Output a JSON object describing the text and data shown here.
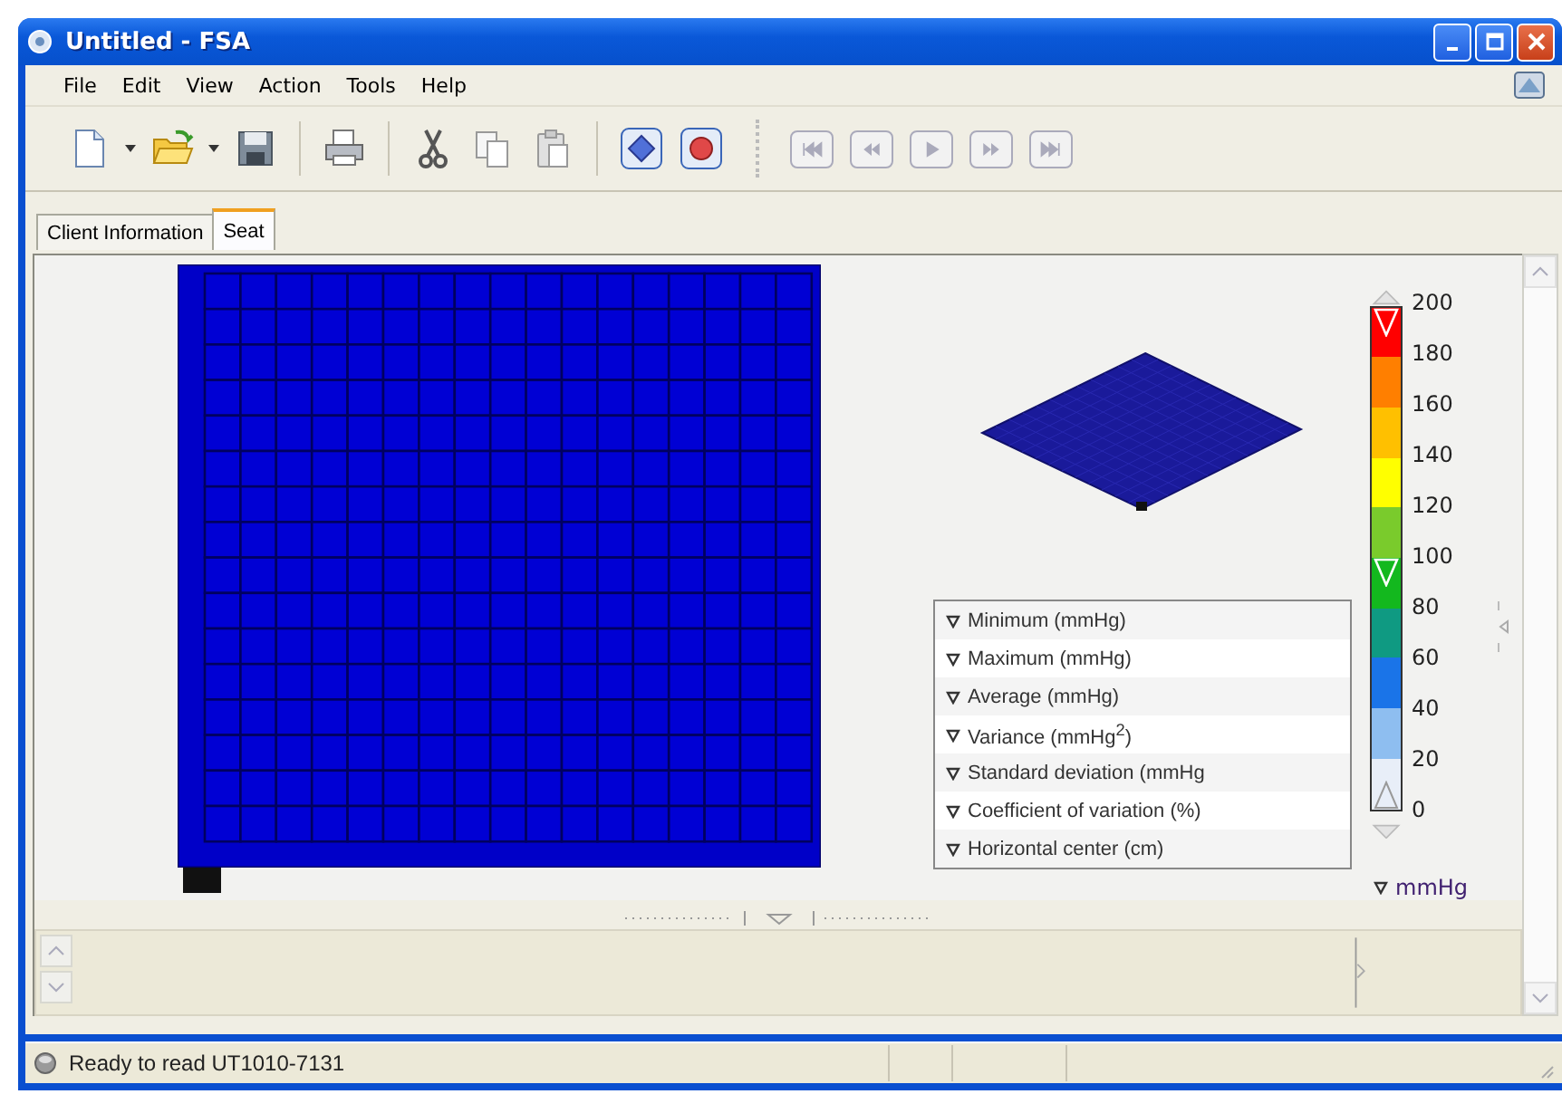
{
  "window": {
    "title": "Untitled - FSA"
  },
  "menu": [
    "File",
    "Edit",
    "View",
    "Action",
    "Tools",
    "Help"
  ],
  "toolbar": [
    {
      "kind": "new"
    },
    {
      "kind": "dropdown"
    },
    {
      "kind": "open"
    },
    {
      "kind": "dropdown"
    },
    {
      "kind": "save"
    },
    {
      "kind": "separator"
    },
    {
      "kind": "print"
    },
    {
      "kind": "separator"
    },
    {
      "kind": "cut"
    },
    {
      "kind": "copy"
    },
    {
      "kind": "paste"
    },
    {
      "kind": "separator"
    },
    {
      "kind": "marker"
    },
    {
      "kind": "record"
    },
    {
      "kind": "grip"
    }
  ],
  "playback": [
    {
      "kind": "first",
      "disabled": true
    },
    {
      "kind": "rewind",
      "disabled": true
    },
    {
      "kind": "play",
      "disabled": true
    },
    {
      "kind": "forward",
      "disabled": true
    },
    {
      "kind": "last",
      "disabled": true
    }
  ],
  "tabs": [
    {
      "label": "Client Information",
      "selected": false
    },
    {
      "label": "Seat",
      "selected": true
    }
  ],
  "statistics": [
    "Minimum (mmHg)",
    "Maximum (mmHg)",
    "Average (mmHg)",
    "Variance (mmHg$^{2}$)",
    "Standard deviation (mmHg",
    "Coefficient of variation (%)",
    "Horizontal center (cm)"
  ],
  "scale": {
    "unit": "mmHg",
    "ticks": [
      "200",
      "180",
      "160",
      "140",
      "120",
      "100",
      "80",
      "60",
      "40",
      "20",
      "0"
    ],
    "segments": [
      {
        "color": "#ff0000"
      },
      {
        "color": "#ff7f00"
      },
      {
        "color": "#ffc000"
      },
      {
        "color": "#ffff00"
      },
      {
        "color": "#7acb2c"
      },
      {
        "color": "#13b81e"
      },
      {
        "color": "#0f9a82"
      },
      {
        "color": "#1a74e8"
      },
      {
        "color": "#8ebef0"
      },
      {
        "color": "#e8eef8"
      }
    ],
    "handles": [
      {
        "level": 1
      },
      {
        "level": 0.5
      },
      {
        "level": 0
      }
    ]
  },
  "status_bar": {
    "text": "Ready to read UT1010-7131"
  }
}
